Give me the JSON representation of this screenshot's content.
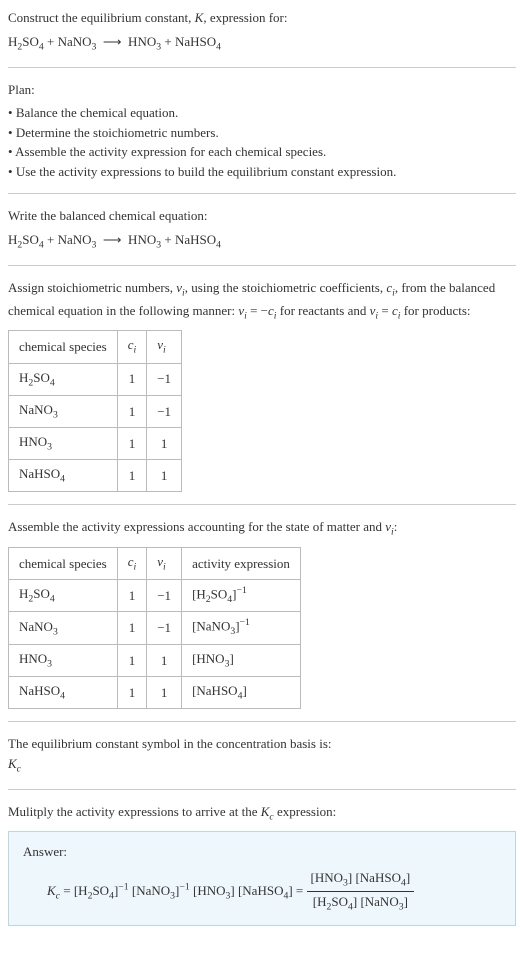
{
  "header": {
    "line1": "Construct the equilibrium constant, <i>K</i>, expression for:",
    "equation": "H<sub>2</sub>SO<sub>4</sub> + NaNO<sub>3</sub> &nbsp;⟶&nbsp; HNO<sub>3</sub> + NaHSO<sub>4</sub>"
  },
  "plan": {
    "title": "Plan:",
    "items": [
      "Balance the chemical equation.",
      "Determine the stoichiometric numbers.",
      "Assemble the activity expression for each chemical species.",
      "Use the activity expressions to build the equilibrium constant expression."
    ]
  },
  "balanced": {
    "title": "Write the balanced chemical equation:",
    "equation": "H<sub>2</sub>SO<sub>4</sub> + NaNO<sub>3</sub> &nbsp;⟶&nbsp; HNO<sub>3</sub> + NaHSO<sub>4</sub>"
  },
  "stoich": {
    "intro": "Assign stoichiometric numbers, <i>ν<sub>i</sub></i>, using the stoichiometric coefficients, <i>c<sub>i</sub></i>, from the balanced chemical equation in the following manner: <i>ν<sub>i</sub></i> = −<i>c<sub>i</sub></i> for reactants and <i>ν<sub>i</sub></i> = <i>c<sub>i</sub></i> for products:",
    "headers": [
      "chemical species",
      "<i>c<sub>i</sub></i>",
      "<i>ν<sub>i</sub></i>"
    ],
    "rows": [
      {
        "species": "H<sub>2</sub>SO<sub>4</sub>",
        "ci": "1",
        "vi": "−1"
      },
      {
        "species": "NaNO<sub>3</sub>",
        "ci": "1",
        "vi": "−1"
      },
      {
        "species": "HNO<sub>3</sub>",
        "ci": "1",
        "vi": "1"
      },
      {
        "species": "NaHSO<sub>4</sub>",
        "ci": "1",
        "vi": "1"
      }
    ]
  },
  "activity": {
    "intro": "Assemble the activity expressions accounting for the state of matter and <i>ν<sub>i</sub></i>:",
    "headers": [
      "chemical species",
      "<i>c<sub>i</sub></i>",
      "<i>ν<sub>i</sub></i>",
      "activity expression"
    ],
    "rows": [
      {
        "species": "H<sub>2</sub>SO<sub>4</sub>",
        "ci": "1",
        "vi": "−1",
        "act": "[H<sub>2</sub>SO<sub>4</sub>]<sup>−1</sup>"
      },
      {
        "species": "NaNO<sub>3</sub>",
        "ci": "1",
        "vi": "−1",
        "act": "[NaNO<sub>3</sub>]<sup>−1</sup>"
      },
      {
        "species": "HNO<sub>3</sub>",
        "ci": "1",
        "vi": "1",
        "act": "[HNO<sub>3</sub>]"
      },
      {
        "species": "NaHSO<sub>4</sub>",
        "ci": "1",
        "vi": "1",
        "act": "[NaHSO<sub>4</sub>]"
      }
    ]
  },
  "symbol": {
    "line1": "The equilibrium constant symbol in the concentration basis is:",
    "line2": "<i>K<sub>c</sub></i>"
  },
  "multiply": {
    "intro": "Mulitply the activity expressions to arrive at the <i>K<sub>c</sub></i> expression:"
  },
  "answer": {
    "label": "Answer:",
    "lhs": "<i>K<sub>c</sub></i> = [H<sub>2</sub>SO<sub>4</sub>]<sup>−1</sup> [NaNO<sub>3</sub>]<sup>−1</sup> [HNO<sub>3</sub>] [NaHSO<sub>4</sub>] = ",
    "num": "[HNO<sub>3</sub>] [NaHSO<sub>4</sub>]",
    "den": "[H<sub>2</sub>SO<sub>4</sub>] [NaNO<sub>3</sub>]"
  }
}
